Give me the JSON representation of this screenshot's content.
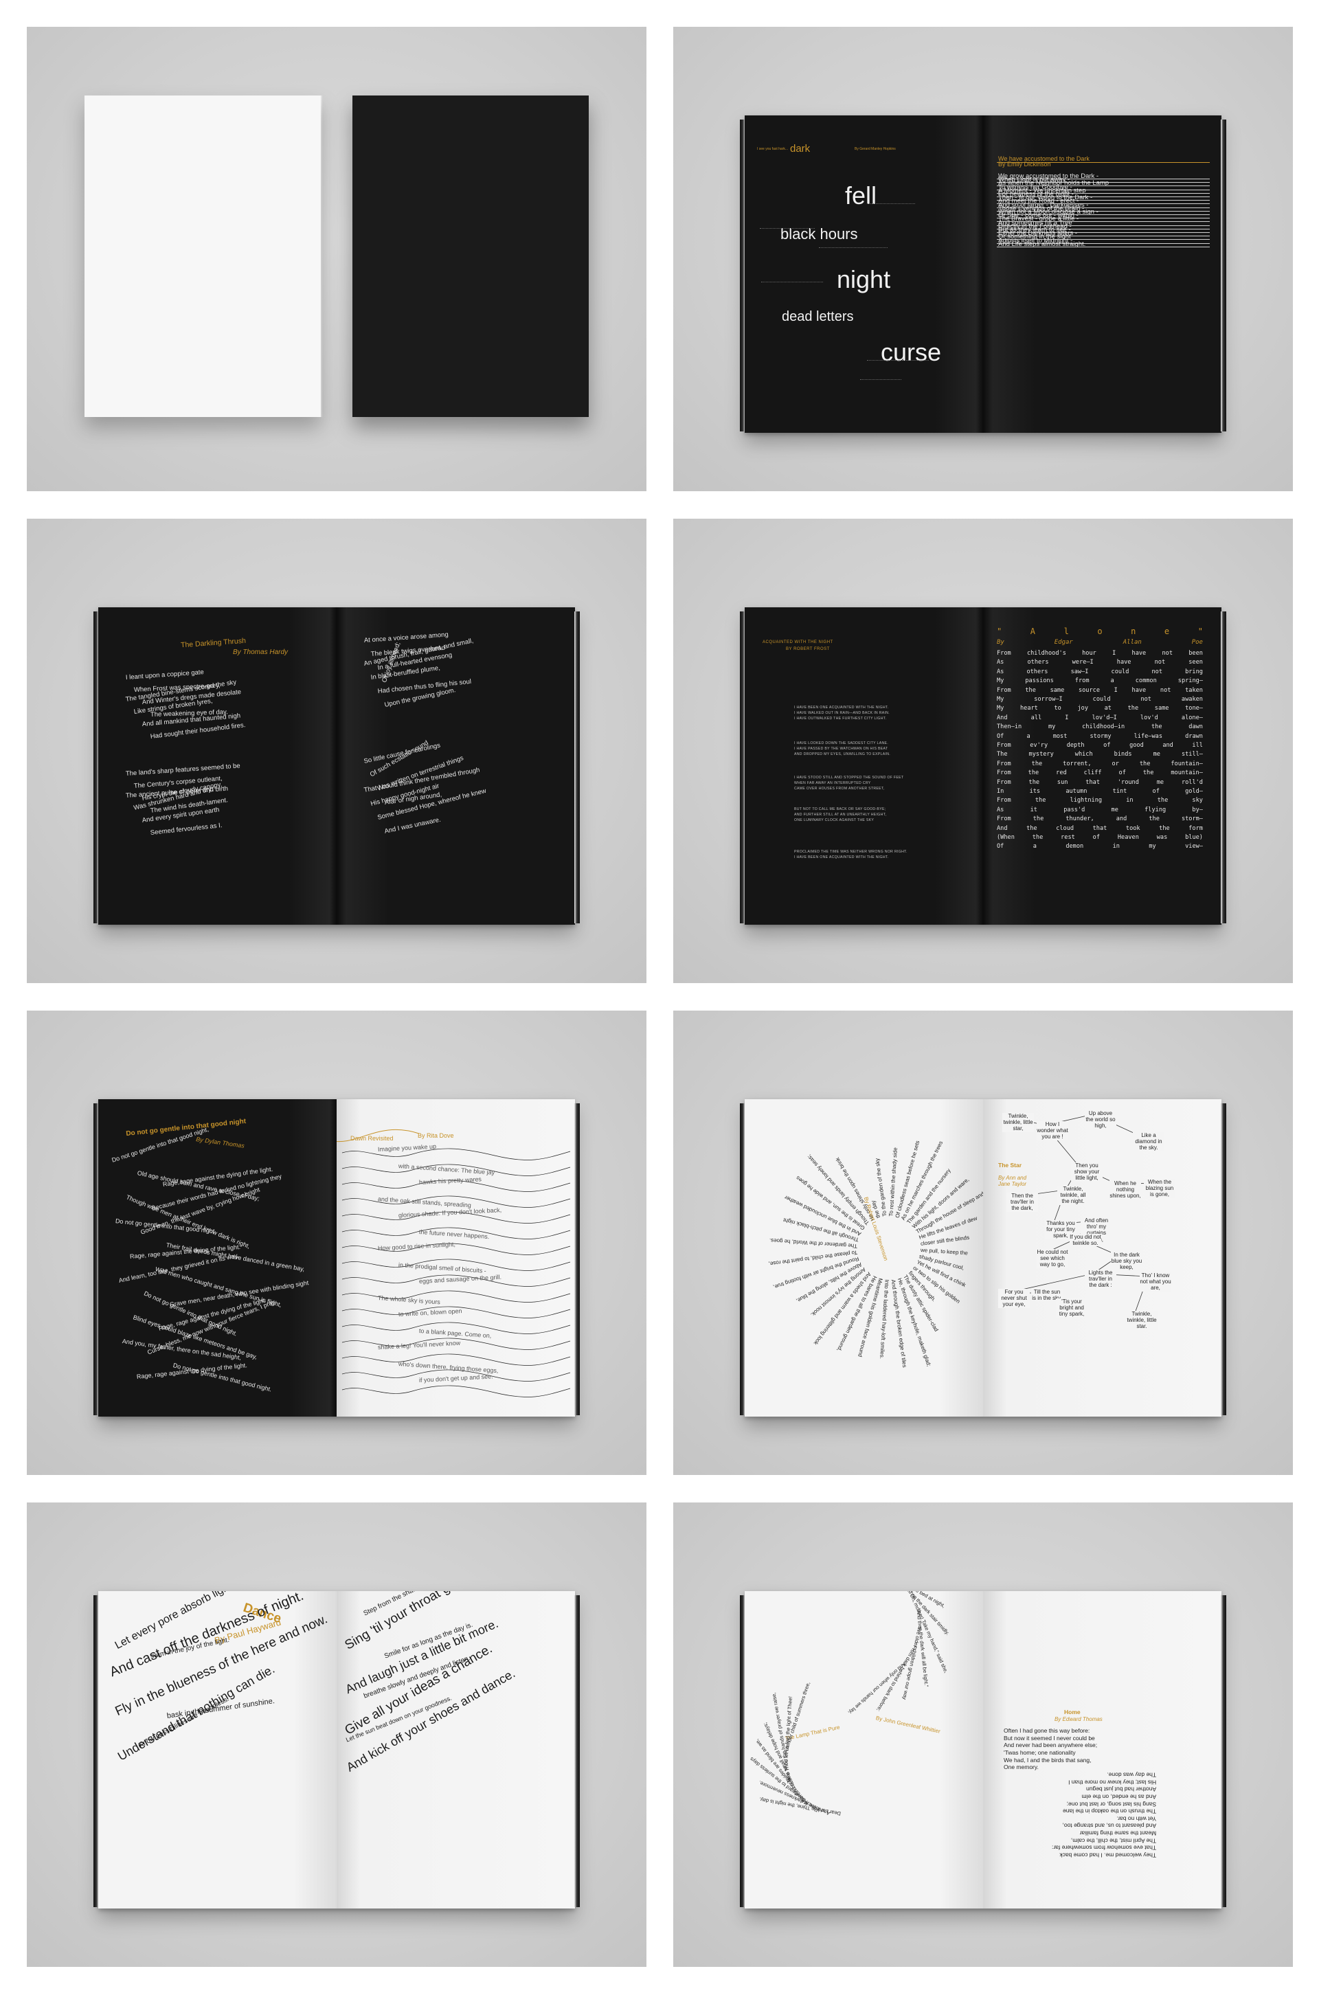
{
  "panels": {
    "cover": {
      "description_only": true
    },
    "dark_spread": {
      "header_small_left": "I see you fast hark...",
      "header_dark": "dark",
      "header_small_right": "By Gerard Manley Hopkins",
      "words": [
        "fell",
        "black hours",
        "night",
        "dead letters",
        "curse"
      ],
      "poem_title": "We have accustomed to the Dark",
      "poem_author": "By Emily Dickinson",
      "stacked_lines": [
        "We grow accustomed to the Dark -",
        "When Light is put away -",
        "As when the Neighbor holds the Lamp",
        "To witness her Goodbye -",
        "A Moment - We uncertain step",
        "For newness of the night -",
        "Then - fit our Vision to the Dark -",
        "And meet the Road - erect -",
        "And so of larger - Darknesses -",
        "Those Evenings of the Brain -",
        "When not a Moon disclose a sign -",
        "Or Star - come out - within -",
        "The Bravest - grope a little -",
        "And sometimes hit a Tree",
        "Directly in the Forehead -",
        "But as they learn to see -",
        "Either the Darkness alters -",
        "Or something in the sight",
        "Adjusts itself to Midnight -",
        "And Life steps almost straight."
      ]
    },
    "darkling_thrush": {
      "title": "The Darkling Thrush",
      "author": "By Thomas Hardy",
      "left_lines": [
        "I leant upon a coppice gate",
        "When Frost was spectre-grey,",
        "And Winter's dregs made desolate",
        "The weakening eye of day.",
        "The tangled bine-stems scored the sky",
        "Like strings of broken lyres,",
        "And all mankind that haunted nigh",
        "Had sought their household fires.",
        "The land's sharp features seemed to be",
        "The Century's corpse outleant,",
        "His crypt the cloudy canopy,",
        "The wind his death-lament.",
        "The ancient pulse of germ and birth",
        "Was shrunken hard and dry,",
        "And every spirit upon earth",
        "Seemed fervourless as I."
      ],
      "right_lines": [
        "At once a voice arose among",
        "The bleak twigs overhead",
        "In a full-hearted evensong",
        "Of joy illimited;",
        "An aged thrush, frail, gaunt, and small,",
        "In blast-beruffled plume,",
        "Had chosen thus to fling his soul",
        "Upon the growing gloom.",
        "So little cause for carolings",
        "Of such ecstatic sound",
        "Was written on terrestrial things",
        "Afar or nigh around,",
        "That I could think there trembled through",
        "His happy good-night air",
        "Some blessed Hope, whereof he knew",
        "And I was unaware."
      ]
    },
    "alone_spread": {
      "left_title": "ACQUAINTED WITH THE NIGHT",
      "left_author": "BY ROBERT FROST",
      "left_lines": [
        "I HAVE BEEN ONE ACQUAINTED WITH THE NIGHT.",
        "I HAVE WALKED OUT IN RAIN—AND BACK IN RAIN.",
        "I HAVE OUTWALKED THE FURTHEST CITY LIGHT.",
        "I HAVE LOOKED DOWN THE SADDEST CITY LANE.",
        "I HAVE PASSED BY THE WATCHMAN ON HIS BEAT",
        "AND DROPPED MY EYES, UNWILLING TO EXPLAIN.",
        "I HAVE STOOD STILL AND STOPPED THE SOUND OF FEET",
        "WHEN FAR AWAY AN INTERRUPTED CRY",
        "CAME OVER HOUSES FROM ANOTHER STREET,",
        "BUT NOT TO CALL ME BACK OR SAY GOOD-BYE;",
        "AND FURTHER STILL AT AN UNEARTHLY HEIGHT,",
        "ONE LUMINARY CLOCK AGAINST THE SKY",
        "PROCLAIMED THE TIME WAS NEITHER WRONG NOR RIGHT.",
        "I HAVE BEEN ONE ACQUAINTED WITH THE NIGHT."
      ],
      "right_title_letters": [
        "\"",
        "A",
        "l",
        "o",
        "n",
        "e",
        "\""
      ],
      "right_author_words": [
        "By",
        "Edgar",
        "Allan",
        "Poe"
      ],
      "right_rows": [
        [
          "From",
          "childhood's",
          "hour",
          "I",
          "have",
          "not",
          "been"
        ],
        [
          "As",
          "others",
          "were—I",
          "have",
          "not",
          "seen"
        ],
        [
          "As",
          "others",
          "saw—I",
          "could",
          "not",
          "bring"
        ],
        [
          "My",
          "passions",
          "from",
          "a",
          "common",
          "spring—"
        ],
        [
          "From",
          "the",
          "same",
          "source",
          "I",
          "have",
          "not",
          "taken"
        ],
        [
          "My",
          "sorrow—I",
          "could",
          "not",
          "awaken"
        ],
        [
          "My",
          "heart",
          "to",
          "joy",
          "at",
          "the",
          "same",
          "tone—"
        ],
        [
          "And",
          "all",
          "I",
          "lov'd—I",
          "lov'd",
          "alone—"
        ],
        [
          "Then—in",
          "my",
          "childhood—in",
          "the",
          "dawn"
        ],
        [
          "Of",
          "a",
          "most",
          "stormy",
          "life—was",
          "drawn"
        ],
        [
          "From",
          "ev'ry",
          "depth",
          "of",
          "good",
          "and",
          "ill"
        ],
        [
          "The",
          "mystery",
          "which",
          "binds",
          "me",
          "still—"
        ],
        [
          "From",
          "the",
          "torrent,",
          "or",
          "the",
          "fountain—"
        ],
        [
          "From",
          "the",
          "red",
          "cliff",
          "of",
          "the",
          "mountain—"
        ],
        [
          "From",
          "the",
          "sun",
          "that",
          "'round",
          "me",
          "roll'd"
        ],
        [
          "In",
          "its",
          "autumn",
          "tint",
          "of",
          "gold—"
        ],
        [
          "From",
          "the",
          "lightning",
          "in",
          "the",
          "sky"
        ],
        [
          "As",
          "it",
          "pass'd",
          "me",
          "flying",
          "by—"
        ],
        [
          "From",
          "the",
          "thunder,",
          "and",
          "the",
          "storm—"
        ],
        [
          "And",
          "the",
          "cloud",
          "that",
          "took",
          "the",
          "form"
        ],
        [
          "(When",
          "the",
          "rest",
          "of",
          "Heaven",
          "was",
          "blue)"
        ],
        [
          "Of",
          "a",
          "demon",
          "in",
          "my",
          "view—"
        ]
      ]
    },
    "gentle_spread": {
      "title": "Do not go gentle into that good night",
      "author": "By Dylan Thomas",
      "left_lines": [
        "Do not go gentle into that good night,",
        "Old age should burn and rave at close of day;",
        "Rage, rage against the dying of the light.",
        "Though wise men at their end know dark is right,",
        "Because their words had forked no lightning they",
        "Do not go gentle into that good night.",
        "Good men, the last wave by, crying how bright",
        "Their frail deeds might have danced in a green bay,",
        "Rage, rage against the dying of the light.",
        "Wild men who caught and sang the sun in flight,",
        "And learn, too late, they grieved it on its way,",
        "Do not go gentle into that good night.",
        "Grave men, near death, who see with blinding sight",
        "Blind eyes could blaze like meteors and be gay,",
        "Rage, rage against the dying of the light.",
        "And you, my father, there on the sad height,",
        "Curse, bless, me now with your fierce tears, I pray.",
        "Do not go gentle into that good night.",
        "Rage, rage against the dying of the light."
      ],
      "right_title": "Dawn Revisited",
      "right_author": "By Rita Dove",
      "right_lines": [
        "Imagine you wake up",
        "with a second chance: The blue jay",
        "hawks his pretty wares",
        "and the oak still stands, spreading",
        "glorious shade. If you don't look back,",
        "the future never happens.",
        "How good to rise in sunlight,",
        "in the prodigal smell of biscuits -",
        "eggs and sausage on the grill.",
        "The whole sky is yours",
        "to write on, blown open",
        "to a blank page. Come on,",
        "shake a leg! You'll never know",
        "who's down there, frying those eggs,",
        "if you don't get up and see."
      ]
    },
    "star_spread": {
      "left_title": "By Robert Louis Stevenson",
      "left_rays": [
        "Through all the pitch-black night",
        "And in the blue unclouded weather",
        "Great is the sun, and wide he goes",
        "Though empty lands and lonely seas;",
        "He only shines upon the brink",
        "the day",
        "To the garden of the sky",
        "To rest within the shady side",
        "Of cloudless seas before he sets",
        "As on he marches through the trees",
        "The garden and the nursery",
        "With his light, doors and ware,",
        "Through the house of sleep and cheer,",
        "He lifts the leaves of dew",
        "closer still the blinds",
        "we pull, to keep the",
        "shady parlour cool,",
        "Yet he will find a chink",
        "or two to slip his golden",
        "fingers through.",
        "The dusty attic spider-clad",
        "He, through the keyhole, maketh glad;",
        "And through the broken edge of tiles",
        "Into the laddered hay-loft smiles.",
        "Meantime his golden face around",
        "He bares to all the garden ground,",
        "And sheds a warm and glittering look",
        "Among the ivy's inmost nook.",
        "Above the hills, along the blue,",
        "Round the bright air with footing true,",
        "To please the child, to paint the rose,",
        "The gardener of the World, he goes."
      ],
      "right_title": "The Star",
      "right_author": "By Ann and Jane Taylor",
      "nodes": [
        "Twinkle, twinkle, little star,",
        "How I wonder what you are !",
        "Up above the world so high,",
        "Like a diamond in the sky.",
        "Then you show your little light,",
        "When the blazing sun is gone,",
        "When he nothing shines upon,",
        "Twinkle, twinkle, all the night.",
        "Then the trav'ller in the dark,",
        "Thanks you for your tiny spark,",
        "And often thro' my curtains peep,",
        "If you did not twinkle so.",
        "He could not see which way to go,",
        "In the dark blue sky you keep,",
        "Lights the trav'ller in the dark :",
        "Tho' I know not what you are,",
        "Twinkle, twinkle, little star.",
        "For you never shut your eye,",
        "Till the sun is in the sky.",
        "'Tis your bright and tiny spark,"
      ]
    },
    "dance_spread": {
      "title": "Dance",
      "author": "By Paul Hayward",
      "left_lines": [
        "Let every pore absorb light,",
        "swim in the joy of the light.",
        "And cast off the darkness of night.",
        "Fly in the blueness of the here and now.",
        "bask in the summer of sunshine.",
        "Know possibilities are boundless.",
        "Understand that nothing can die."
      ],
      "right_lines": [
        "Step from the shadows of torment.",
        "Sing 'til your throat gets too sore.",
        "Smile for as long as the day is.",
        "And laugh just a little bit more.",
        "breathe slowly and deeply and listen.",
        "Give all your ideas a chance.",
        "Let the sun beat down on your goodness.",
        "And kick off your shoes and dance."
      ]
    },
    "home_spread": {
      "left_title": "The Lamp That is Pure",
      "left_author": "By John Greenleaf Whittier",
      "left_arc_lines": [
        "Seeking her little bed at night,",
        "Paused on the dark stair timidly.",
        "\"Oh, mother! Take my hand,\" said she,",
        "\"And then the dark will all be light.\"",
        "We older children grope our way",
        "From dark behind to dark before;",
        "And only when our hands we lay,",
        "Dear Lord, in Thine, the night is day,",
        "And there is darkness nevermore.",
        "Reach downward to the sunless days",
        "Wherein our guides are blind as we,",
        "And faith is small and hope delays;",
        "Take Thou the hands of prayer we raise,",
        "And let us feel the light of Thee!",
        "A tender child of summers three,"
      ],
      "right_title": "Home",
      "right_author": "By Edward Thomas",
      "right_lines": [
        "Often I had gone this way before:",
        "But now it seemed I never could be",
        "And never had been anywhere else;",
        "'Twas home; one nationality",
        "We had, I and the birds that sang,",
        "One memory."
      ],
      "right_upside_lines": [
        "They welcomed me. I had come back",
        "That eve somehow from somewhere far:",
        "The April mist, the chill, the calm,",
        "Meant the same thing familiar",
        "And pleasant to us, and strange too,",
        "Yet with no bar.",
        "The thrush on the oaktop in the lane",
        "Sang his last song, or last but one;",
        "And as he ended, on the elm",
        "Another had but just begun",
        "His last; they knew no more than I",
        "The day was done."
      ]
    }
  },
  "colors": {
    "accent_gold": "#c7932a",
    "page_black": "#161616",
    "page_white": "#f4f4f4",
    "backdrop_grey": "#cfcfcf"
  }
}
